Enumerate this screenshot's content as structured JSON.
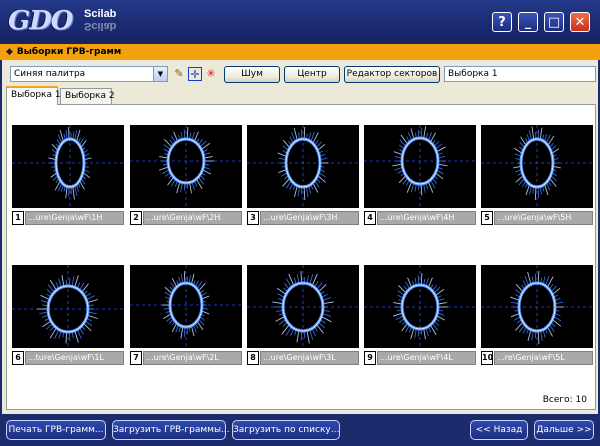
{
  "window": {
    "logo_text": "GDO",
    "logo_sub": "Scilab",
    "help_label": "?",
    "minimize_label": "_",
    "maximize_label": "□",
    "close_label": "✕"
  },
  "header": {
    "title": "Выборки ГРВ-грамм"
  },
  "toolbar": {
    "palette_value": "Синяя палитра",
    "noise_label": "Шум",
    "center_label": "Центр",
    "sector_editor_label": "Редактор секторов",
    "selection_name_value": "Выборка 1"
  },
  "tabs": [
    {
      "label": "Выборка 1",
      "active": true
    },
    {
      "label": "Выборка 2",
      "active": false
    }
  ],
  "images": [
    {
      "num": "1",
      "path": "...ure\\Genja\\wF\\1H"
    },
    {
      "num": "2",
      "path": "...ure\\Genja\\wF\\2H"
    },
    {
      "num": "3",
      "path": "...ure\\Genja\\wF\\3H"
    },
    {
      "num": "4",
      "path": "...ure\\Genja\\wF\\4H"
    },
    {
      "num": "5",
      "path": "...ure\\Genja\\wF\\5H"
    },
    {
      "num": "6",
      "path": "...ture\\Genja\\wF\\1L"
    },
    {
      "num": "7",
      "path": "...ure\\Genja\\wF\\2L"
    },
    {
      "num": "8",
      "path": "...ure\\Genja\\wF\\3L"
    },
    {
      "num": "9",
      "path": "...ure\\Genja\\wF\\4L"
    },
    {
      "num": "10",
      "path": "...re\\Genja\\wF\\5L"
    }
  ],
  "status": {
    "total": "Всего: 10"
  },
  "bottom": {
    "print_label": "Печать ГРВ-грамм...",
    "load_label": "Загрузить ГРВ-граммы...",
    "load_list_label": "Загрузить по списку...",
    "back_label": "<< Назад",
    "next_label": "Дальше >>"
  },
  "colors": {
    "frame": "#1b2b6b",
    "header": "#f2a20c",
    "glow": "#3a7bff"
  }
}
